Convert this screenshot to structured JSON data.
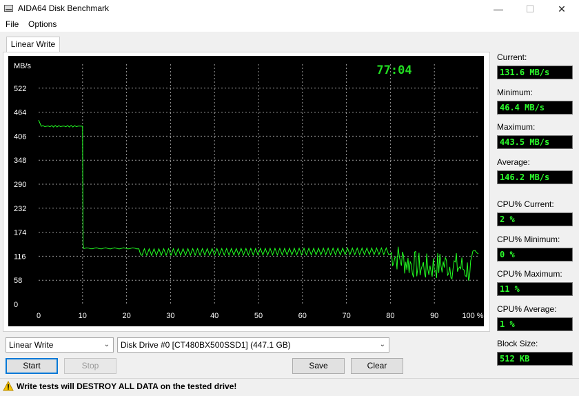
{
  "window": {
    "title": "AIDA64 Disk Benchmark",
    "controls": {
      "minimize": "—",
      "maximize": "☐",
      "close": "✕"
    }
  },
  "menu": {
    "items": [
      "File",
      "Options"
    ]
  },
  "tab": {
    "label": "Linear Write"
  },
  "chart_data": {
    "type": "line",
    "elapsed_time": "77:04",
    "y_unit_label": "MB/s",
    "y_ticks": [
      "522",
      "464",
      "406",
      "348",
      "290",
      "232",
      "174",
      "116",
      "58",
      "0"
    ],
    "x_ticks": [
      "0",
      "10",
      "20",
      "30",
      "40",
      "50",
      "60",
      "70",
      "80",
      "90",
      "100 %"
    ],
    "xlim": [
      0,
      100
    ],
    "ylim": [
      0,
      580
    ],
    "grid": true,
    "line_color": "#22ff22",
    "background": "#000000",
    "series": [
      {
        "x": [
          0,
          0.5,
          1,
          9.8,
          10,
          10.1,
          10.3,
          23,
          23.2,
          23.5,
          80,
          84,
          88,
          92,
          96,
          98,
          100
        ],
        "y": [
          445,
          433,
          430,
          430,
          430,
          145,
          135,
          135,
          120,
          120,
          122,
          100,
          88,
          96,
          90,
          82,
          118
        ]
      }
    ]
  },
  "stats": [
    {
      "label": "Current:",
      "value": "131.6 MB/s"
    },
    {
      "label": "Minimum:",
      "value": "46.4 MB/s"
    },
    {
      "label": "Maximum:",
      "value": "443.5 MB/s"
    },
    {
      "label": "Average:",
      "value": "146.2 MB/s"
    },
    {
      "label": "CPU% Current:",
      "value": "2 %"
    },
    {
      "label": "CPU% Minimum:",
      "value": "0 %"
    },
    {
      "label": "CPU% Maximum:",
      "value": "11 %"
    },
    {
      "label": "CPU% Average:",
      "value": "1 %"
    },
    {
      "label": "Block Size:",
      "value": "512 KB"
    }
  ],
  "controls": {
    "test_select": "Linear Write",
    "drive_select": "Disk Drive #0  [CT480BX500SSD1]  (447.1 GB)",
    "start": "Start",
    "stop": "Stop",
    "save": "Save",
    "clear": "Clear"
  },
  "warning": {
    "text": "Write tests will DESTROY ALL DATA on the tested drive!"
  }
}
